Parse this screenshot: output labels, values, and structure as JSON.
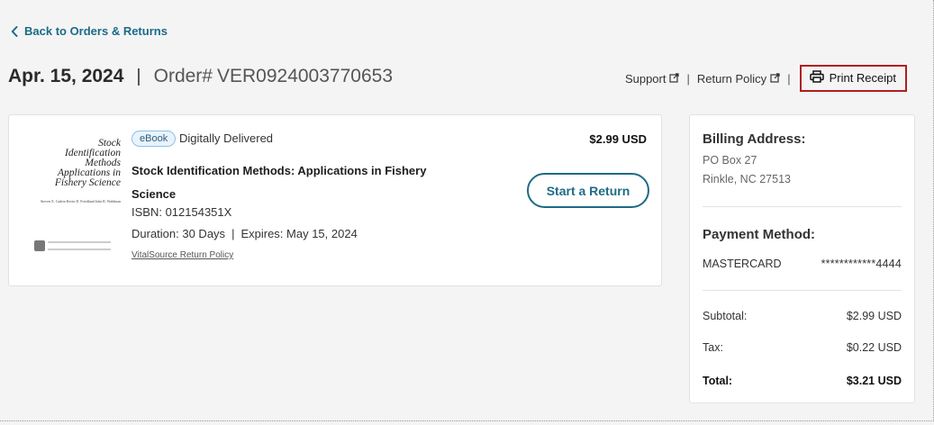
{
  "nav": {
    "back_label": "Back to Orders & Returns"
  },
  "order": {
    "date": "Apr. 15, 2024",
    "separator": "|",
    "number_label": "Order#",
    "number": "VER0924003770653"
  },
  "links": {
    "support": "Support",
    "return_policy": "Return Policy",
    "print_receipt": "Print Receipt",
    "separator": "|"
  },
  "item": {
    "badge": "eBook",
    "delivery": "Digitally Delivered",
    "price": "$2.99 USD",
    "title": "Stock Identification Methods: Applications in Fishery Science",
    "isbn": "ISBN: 012154351X",
    "duration": "Duration: 30 Days",
    "duration_sep": "|",
    "expires": "Expires: May 15, 2024",
    "policy_link": "VitalSource Return Policy",
    "return_button": "Start a Return",
    "cover": {
      "line1": "Stock",
      "line2": "Identification",
      "line3": "Methods",
      "line4": "Applications in",
      "line5": "Fishery Science",
      "authors": "Steven X. Cadrin Kevin D. Friedland John R. Waldman"
    }
  },
  "summary": {
    "billing_heading": "Billing Address:",
    "address_line1": "PO Box 27",
    "address_line2": "Rinkle, NC 27513",
    "payment_heading": "Payment Method:",
    "card_type": "MASTERCARD",
    "card_number": "************4444",
    "subtotal_label": "Subtotal:",
    "subtotal_value": "$2.99 USD",
    "tax_label": "Tax:",
    "tax_value": "$0.22 USD",
    "total_label": "Total:",
    "total_value": "$3.21 USD"
  },
  "colors": {
    "link": "#1a6a8a",
    "highlight_border": "#b01e1e",
    "badge_bg": "#e8f3fb"
  }
}
